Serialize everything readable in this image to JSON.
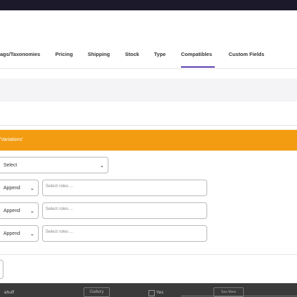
{
  "tabs": [
    {
      "label": "ags/Taxonomies",
      "active": false
    },
    {
      "label": "Pricing",
      "active": false
    },
    {
      "label": "Shipping",
      "active": false
    },
    {
      "label": "Stock",
      "active": false
    },
    {
      "label": "Type",
      "active": false
    },
    {
      "label": "Compatibles",
      "active": true
    },
    {
      "label": "Custom Fields",
      "active": false
    }
  ],
  "section_bar": {
    "title": "'Variations'",
    "color": "#f39c12"
  },
  "main_select": {
    "value": "Select"
  },
  "role_rows": [
    {
      "mode": "Append",
      "roles_placeholder": "Select roles ..."
    },
    {
      "mode": "Append",
      "roles_placeholder": "Select roles ..."
    },
    {
      "mode": "Append",
      "roles_placeholder": "Select roles ..."
    }
  ],
  "footer": {
    "left_text": "ahuff",
    "button_label": "Gallery",
    "checkbox_label": "Yes",
    "right_button_label": "See More"
  },
  "colors": {
    "accent": "#5b3fb0",
    "topbar": "#1c1a2a"
  }
}
